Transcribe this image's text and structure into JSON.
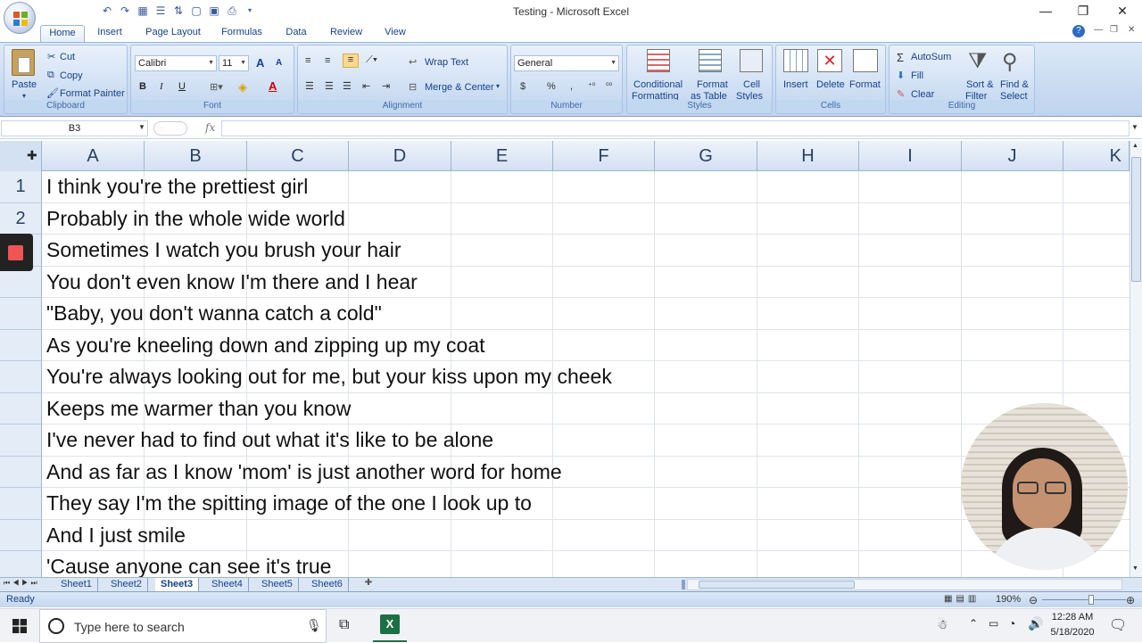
{
  "window": {
    "title": "Testing - Microsoft Excel",
    "minimize": "—",
    "restore": "❐",
    "close": "✕"
  },
  "tabs": [
    "Home",
    "Insert",
    "Page Layout",
    "Formulas",
    "Data",
    "Review",
    "View"
  ],
  "ribbon": {
    "clipboard": {
      "paste": "Paste",
      "cut": "Cut",
      "copy": "Copy",
      "format_painter": "Format Painter",
      "label": "Clipboard"
    },
    "font": {
      "name": "Calibri",
      "size": "11",
      "bold": "B",
      "italic": "I",
      "underline": "U",
      "grow": "A",
      "shrink": "A",
      "label": "Font"
    },
    "alignment": {
      "wrap_text": "Wrap Text",
      "merge_center": "Merge & Center",
      "label": "Alignment"
    },
    "number": {
      "format": "General",
      "currency": "$",
      "percent": "%",
      "comma": ",",
      "label": "Number"
    },
    "styles": {
      "conditional_1": "Conditional",
      "conditional_2": "Formatting",
      "format_table_1": "Format",
      "format_table_2": "as Table",
      "cell_styles_1": "Cell",
      "cell_styles_2": "Styles",
      "label": "Styles"
    },
    "cells": {
      "insert": "Insert",
      "delete": "Delete",
      "format": "Format",
      "label": "Cells"
    },
    "editing": {
      "autosum": "AutoSum",
      "fill": "Fill",
      "clear": "Clear",
      "sort_1": "Sort &",
      "sort_2": "Filter",
      "find_1": "Find &",
      "find_2": "Select",
      "label": "Editing"
    }
  },
  "formula_bar": {
    "name_box": "B3",
    "fx": "fx",
    "value": ""
  },
  "columns": [
    "A",
    "B",
    "C",
    "D",
    "E",
    "F",
    "G",
    "H",
    "I",
    "J",
    "K"
  ],
  "row_numbers": [
    "1",
    "2",
    "",
    "",
    "",
    "",
    "",
    "",
    "",
    "",
    "",
    "",
    ""
  ],
  "rows": [
    "I think you're the prettiest girl",
    "Probably in the whole wide world",
    "Sometimes I watch you brush your hair",
    "You don't even know I'm there and I hear",
    "\"Baby, you don't wanna catch a cold\"",
    "As you're kneeling down and zipping up my coat",
    "You're always looking out for me, but your kiss upon my cheek",
    "Keeps me warmer than you know",
    "I've never had to find out what it's like to be alone",
    "And as far as I know 'mom' is just another word for home",
    "They say I'm the spitting image of the one I look up to",
    "And I just smile",
    "'Cause anyone can see it's true"
  ],
  "sheets": [
    "Sheet1",
    "Sheet2",
    "Sheet3",
    "Sheet4",
    "Sheet5",
    "Sheet6"
  ],
  "active_sheet": "Sheet3",
  "status": {
    "ready": "Ready",
    "zoom": "190%"
  },
  "taskbar": {
    "search_placeholder": "Type here to search",
    "time": "12:28 AM",
    "date": "5/18/2020"
  }
}
